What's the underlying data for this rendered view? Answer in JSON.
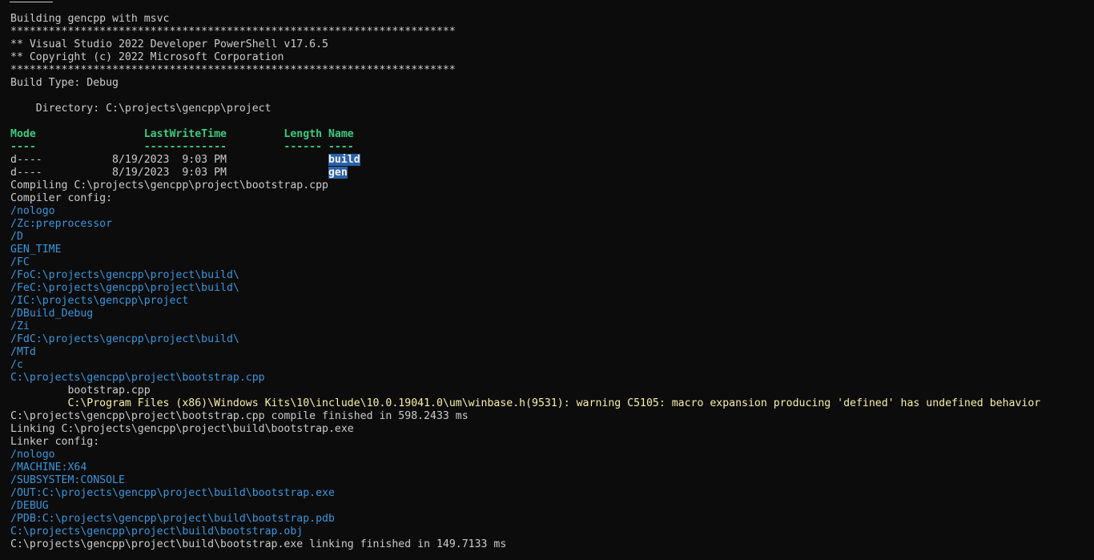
{
  "terminal": {
    "lines": [
      {
        "parts": [
          {
            "t": "Building gencpp with msvc",
            "c": "white"
          }
        ]
      },
      {
        "parts": [
          {
            "t": "**********************************************************************",
            "c": "white"
          }
        ]
      },
      {
        "parts": [
          {
            "t": "** Visual Studio 2022 Developer PowerShell v17.6.5",
            "c": "white"
          }
        ]
      },
      {
        "parts": [
          {
            "t": "** Copyright (c) 2022 Microsoft Corporation",
            "c": "white"
          }
        ]
      },
      {
        "parts": [
          {
            "t": "**********************************************************************",
            "c": "white"
          }
        ]
      },
      {
        "parts": [
          {
            "t": "Build Type: Debug",
            "c": "white"
          }
        ]
      },
      {
        "parts": [
          {
            "t": "",
            "c": "white"
          }
        ]
      },
      {
        "parts": [
          {
            "t": "    Directory: C:\\projects\\gencpp\\project",
            "c": "white"
          }
        ]
      },
      {
        "parts": [
          {
            "t": "",
            "c": "white"
          }
        ]
      },
      {
        "parts": [
          {
            "t": "Mode                 LastWriteTime         Length Name",
            "c": "hdr"
          }
        ]
      },
      {
        "parts": [
          {
            "t": "----                 -------------         ------ ----",
            "c": "hdr"
          }
        ]
      },
      {
        "parts": [
          {
            "t": "d----           8/19/2023  9:03 PM                ",
            "c": "white"
          },
          {
            "t": "build",
            "c": "sel"
          }
        ]
      },
      {
        "parts": [
          {
            "t": "d----           8/19/2023  9:03 PM                ",
            "c": "white"
          },
          {
            "t": "gen",
            "c": "sel"
          }
        ]
      },
      {
        "parts": [
          {
            "t": "Compiling C:\\projects\\gencpp\\project\\bootstrap.cpp",
            "c": "white"
          }
        ]
      },
      {
        "parts": [
          {
            "t": "Compiler config:",
            "c": "white"
          }
        ]
      },
      {
        "parts": [
          {
            "t": "/nologo",
            "c": "blue"
          }
        ]
      },
      {
        "parts": [
          {
            "t": "/Zc:preprocessor",
            "c": "blue"
          }
        ]
      },
      {
        "parts": [
          {
            "t": "/D",
            "c": "blue"
          }
        ]
      },
      {
        "parts": [
          {
            "t": "GEN_TIME",
            "c": "blue"
          }
        ]
      },
      {
        "parts": [
          {
            "t": "/FC",
            "c": "blue"
          }
        ]
      },
      {
        "parts": [
          {
            "t": "/FoC:\\projects\\gencpp\\project\\build\\",
            "c": "blue"
          }
        ]
      },
      {
        "parts": [
          {
            "t": "/FeC:\\projects\\gencpp\\project\\build\\",
            "c": "blue"
          }
        ]
      },
      {
        "parts": [
          {
            "t": "/IC:\\projects\\gencpp\\project",
            "c": "blue"
          }
        ]
      },
      {
        "parts": [
          {
            "t": "/DBuild_Debug",
            "c": "blue"
          }
        ]
      },
      {
        "parts": [
          {
            "t": "/Zi",
            "c": "blue"
          }
        ]
      },
      {
        "parts": [
          {
            "t": "/FdC:\\projects\\gencpp\\project\\build\\",
            "c": "blue"
          }
        ]
      },
      {
        "parts": [
          {
            "t": "/MTd",
            "c": "blue"
          }
        ]
      },
      {
        "parts": [
          {
            "t": "/c",
            "c": "blue"
          }
        ]
      },
      {
        "parts": [
          {
            "t": "C:\\projects\\gencpp\\project\\bootstrap.cpp",
            "c": "blue"
          }
        ]
      },
      {
        "parts": [
          {
            "t": "         bootstrap.cpp",
            "c": "white"
          }
        ]
      },
      {
        "parts": [
          {
            "t": "         C:\\Program Files (x86)\\Windows Kits\\10\\include\\10.0.19041.0\\um\\winbase.h(9531): warning C5105: macro expansion producing 'defined' has undefined behavior",
            "c": "yellow"
          }
        ]
      },
      {
        "parts": [
          {
            "t": "C:\\projects\\gencpp\\project\\bootstrap.cpp compile finished in 598.2433 ms",
            "c": "white"
          }
        ]
      },
      {
        "parts": [
          {
            "t": "Linking C:\\projects\\gencpp\\project\\build\\bootstrap.exe",
            "c": "white"
          }
        ]
      },
      {
        "parts": [
          {
            "t": "Linker config:",
            "c": "white"
          }
        ]
      },
      {
        "parts": [
          {
            "t": "/nologo",
            "c": "blue"
          }
        ]
      },
      {
        "parts": [
          {
            "t": "/MACHINE:X64",
            "c": "blue"
          }
        ]
      },
      {
        "parts": [
          {
            "t": "/SUBSYSTEM:CONSOLE",
            "c": "blue"
          }
        ]
      },
      {
        "parts": [
          {
            "t": "/OUT:C:\\projects\\gencpp\\project\\build\\bootstrap.exe",
            "c": "blue"
          }
        ]
      },
      {
        "parts": [
          {
            "t": "/DEBUG",
            "c": "blue"
          }
        ]
      },
      {
        "parts": [
          {
            "t": "/PDB:C:\\projects\\gencpp\\project\\build\\bootstrap.pdb",
            "c": "blue"
          }
        ]
      },
      {
        "parts": [
          {
            "t": "C:\\projects\\gencpp\\project\\build\\bootstrap.obj",
            "c": "blue"
          }
        ]
      },
      {
        "parts": [
          {
            "t": "C:\\projects\\gencpp\\project\\build\\bootstrap.exe linking finished in 149.7133 ms",
            "c": "white"
          }
        ]
      }
    ]
  },
  "colors": {
    "background": "#0c0c0c",
    "text": "#cccccc",
    "header": "#3bcb82",
    "option": "#3a96dd",
    "warning": "#f9f1a5",
    "selection": "#2a62a8"
  }
}
